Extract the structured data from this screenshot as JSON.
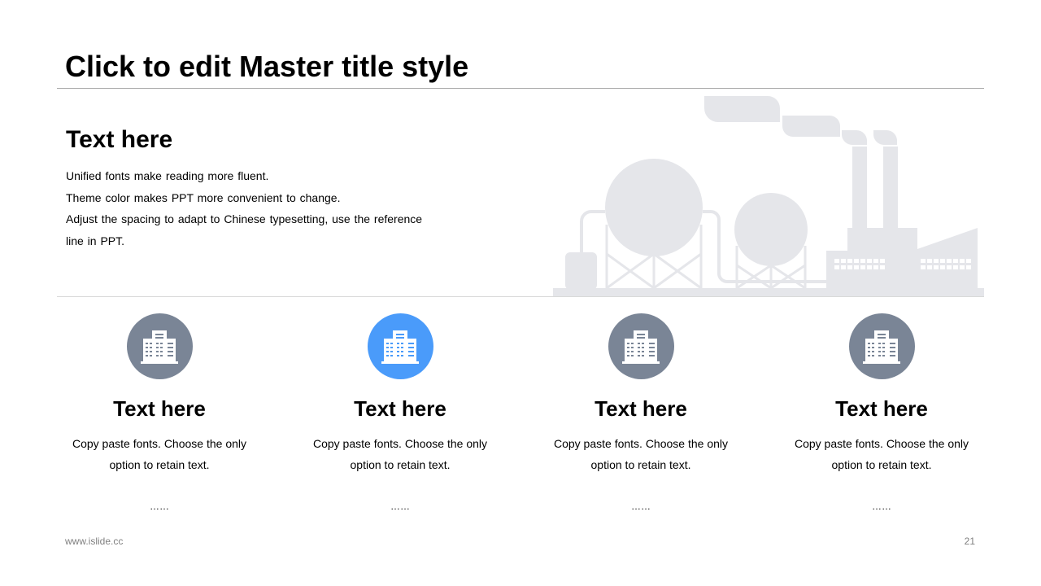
{
  "slide": {
    "title": "Click to edit Master title style"
  },
  "intro": {
    "heading": "Text here",
    "lines": [
      "Unified fonts make reading more fluent.",
      "Theme color makes PPT more convenient to change.",
      "Adjust the spacing to adapt to Chinese typesetting, use the reference",
      "line in PPT."
    ]
  },
  "cards": [
    {
      "heading": "Text here",
      "body_line1": "Copy paste fonts. Choose the only",
      "body_line2": "option to retain text.",
      "more": "……",
      "icon": "building-icon",
      "color": "#7a8596"
    },
    {
      "heading": "Text here",
      "body_line1": "Copy paste fonts. Choose the only",
      "body_line2": "option to retain text.",
      "more": "……",
      "icon": "building-icon",
      "color": "#4a9bfa"
    },
    {
      "heading": "Text here",
      "body_line1": "Copy paste fonts. Choose the only",
      "body_line2": "option to retain text.",
      "more": "……",
      "icon": "building-icon",
      "color": "#7a8596"
    },
    {
      "heading": "Text here",
      "body_line1": "Copy paste fonts. Choose the only",
      "body_line2": "option to retain text.",
      "more": "……",
      "icon": "building-icon",
      "color": "#7a8596"
    }
  ],
  "illustration": {
    "icon": "factory-illustration",
    "color": "#e5e6ea"
  },
  "footer": {
    "url": "www.islide.cc",
    "page_number": "21"
  }
}
